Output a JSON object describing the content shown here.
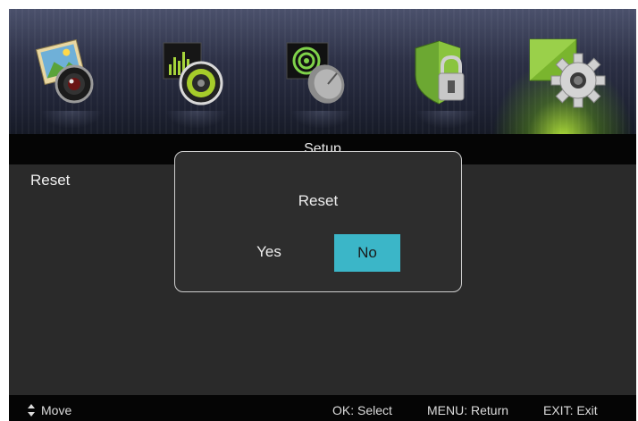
{
  "menu_icons": [
    {
      "name": "picture-icon"
    },
    {
      "name": "sound-icon"
    },
    {
      "name": "channel-icon"
    },
    {
      "name": "lock-icon"
    },
    {
      "name": "setup-icon",
      "active": true
    }
  ],
  "header": {
    "title": "Setup"
  },
  "menu": {
    "items": [
      {
        "label": "Reset"
      }
    ]
  },
  "dialog": {
    "title": "Reset",
    "buttons": {
      "yes": "Yes",
      "no": "No"
    },
    "selected": "No"
  },
  "footer": {
    "move": "Move",
    "select": "OK: Select",
    "return": "MENU: Return",
    "exit": "EXIT: Exit"
  },
  "colors": {
    "accent": "#3bb6c8",
    "active_glow": "#b8f03c",
    "panel_bg": "#2a2a2a",
    "bar_bg": "#050505"
  }
}
